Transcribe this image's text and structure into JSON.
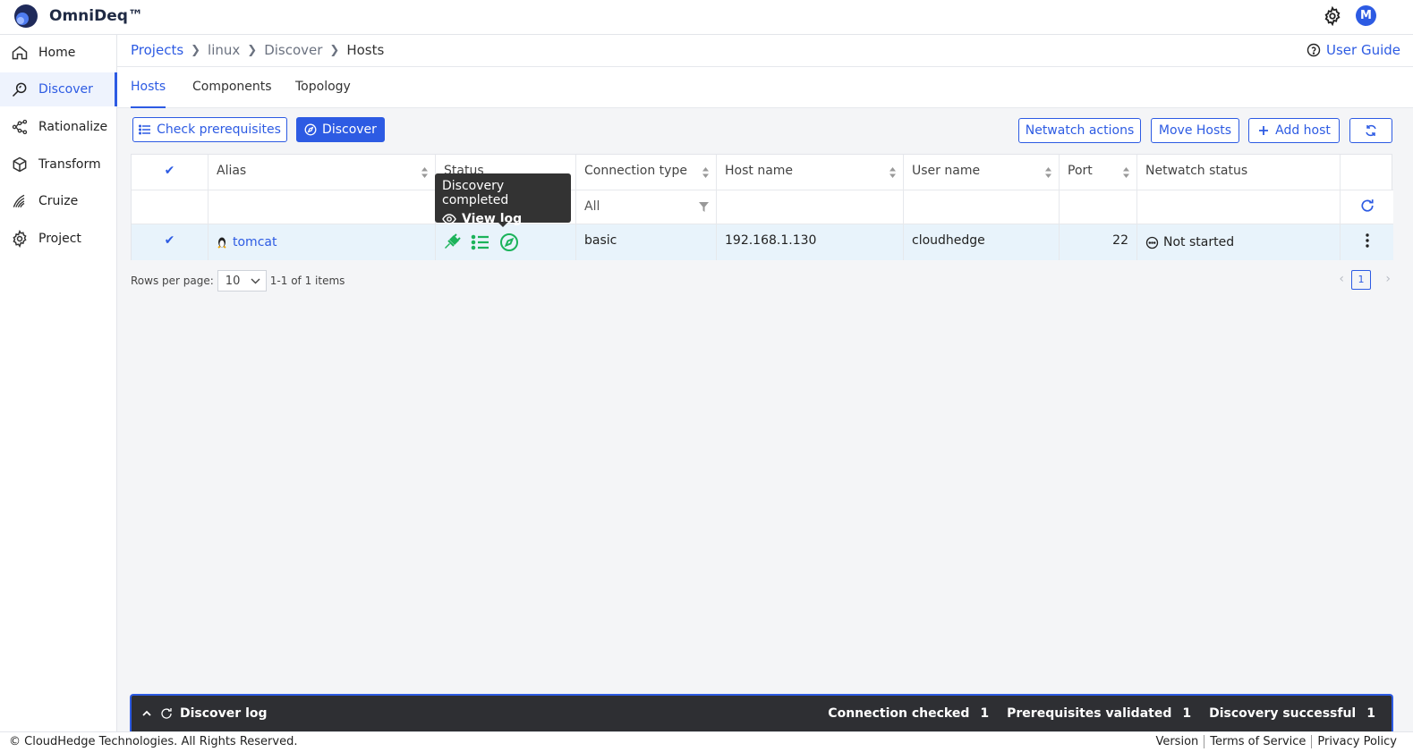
{
  "app": {
    "brand": "OmniDeq™",
    "avatar_initial": "M"
  },
  "sidebar": {
    "items": [
      {
        "label": "Home",
        "icon": "home-icon"
      },
      {
        "label": "Discover",
        "icon": "discover-icon",
        "active": true
      },
      {
        "label": "Rationalize",
        "icon": "rationalize-icon"
      },
      {
        "label": "Transform",
        "icon": "cube-icon"
      },
      {
        "label": "Cruize",
        "icon": "cruize-icon"
      },
      {
        "label": "Project",
        "icon": "gear-icon"
      }
    ]
  },
  "breadcrumb": [
    "Projects",
    "linux",
    "Discover",
    "Hosts"
  ],
  "header": {
    "user_guide": "User Guide"
  },
  "tabs": [
    {
      "label": "Hosts",
      "active": true
    },
    {
      "label": "Components"
    },
    {
      "label": "Topology"
    }
  ],
  "toolbar": {
    "check_prereq": "Check prerequisites",
    "discover": "Discover",
    "netwatch_actions": "Netwatch actions",
    "move_hosts": "Move Hosts",
    "add_host": "Add host"
  },
  "table": {
    "columns": [
      "Alias",
      "Status",
      "Connection type",
      "Host name",
      "User name",
      "Port",
      "Netwatch status"
    ],
    "filters": {
      "connection_type": "All"
    },
    "rows": [
      {
        "alias": "tomcat",
        "connection_type": "basic",
        "host_name": "192.168.1.130",
        "user_name": "cloudhedge",
        "port": "22",
        "netwatch_status": "Not started"
      }
    ]
  },
  "tooltip": {
    "title": "Discovery completed",
    "action": "View log"
  },
  "pager": {
    "rows_per_page_label": "Rows per page:",
    "rows_per_page": "10",
    "range": "1-1 of 1 items",
    "page": "1"
  },
  "log": {
    "title": "Discover log",
    "stats": [
      {
        "label": "Connection checked",
        "value": "1"
      },
      {
        "label": "Prerequisites validated",
        "value": "1"
      },
      {
        "label": "Discovery successful",
        "value": "1"
      }
    ]
  },
  "footer": {
    "copyright": "© CloudHedge Technologies. All Rights Reserved.",
    "links": [
      "Version",
      "Terms of Service",
      "Privacy Policy"
    ]
  },
  "colors": {
    "accent": "#2d5be3",
    "success": "#1bb35a",
    "row_selected": "#e8f3fb",
    "logbar": "#2e2f33"
  }
}
